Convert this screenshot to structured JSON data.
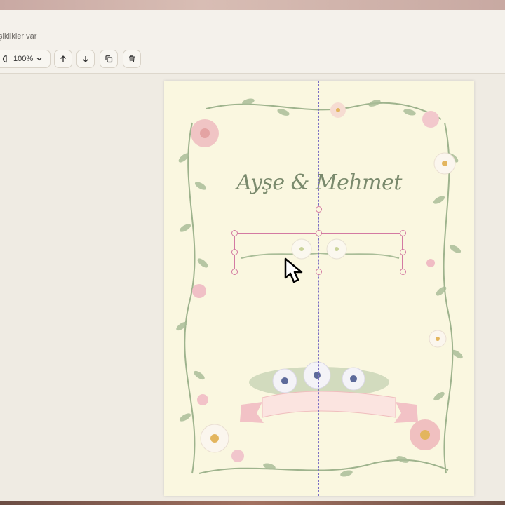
{
  "window": {
    "status_text": "şiklikler var"
  },
  "toolbar": {
    "zoom_value": "100%",
    "zoom_icon": "zoom-icon",
    "buttons": [
      {
        "name": "move-up",
        "icon": "arrow-up-icon"
      },
      {
        "name": "move-down",
        "icon": "arrow-down-icon"
      },
      {
        "name": "duplicate",
        "icon": "copy-icon"
      },
      {
        "name": "delete",
        "icon": "trash-icon"
      }
    ]
  },
  "invitation": {
    "names": "Ayşe & Mehmet",
    "colors": {
      "paper": "#faf7e0",
      "names_text": "#7a8a6d",
      "selection": "#d37aa2",
      "guide": "#7b6fc4"
    }
  }
}
